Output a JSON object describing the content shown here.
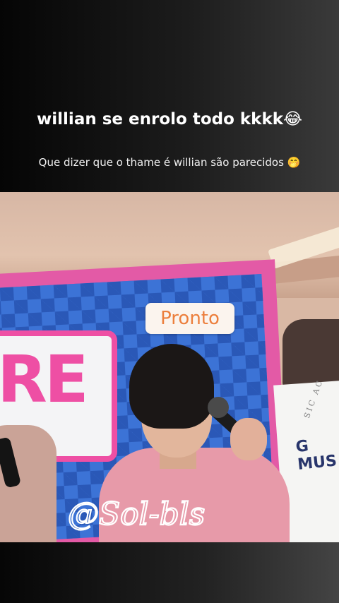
{
  "header": {
    "title": "willian se enrolo todo kkkk😂",
    "subtitle": "Que dizer que o thame é willian são parecidos 🤭"
  },
  "video": {
    "caption": "Pronto",
    "sign_letters": "RE",
    "banner_text": "G MUS",
    "banner_small_text": "SIC AC"
  },
  "watermark": {
    "text": "@Sol-bls",
    "color": "#ffffff"
  },
  "colors": {
    "caption_text": "#ec7f3d",
    "stage_pink": "#ee4fa4",
    "stage_blue": "#3c73d6"
  }
}
